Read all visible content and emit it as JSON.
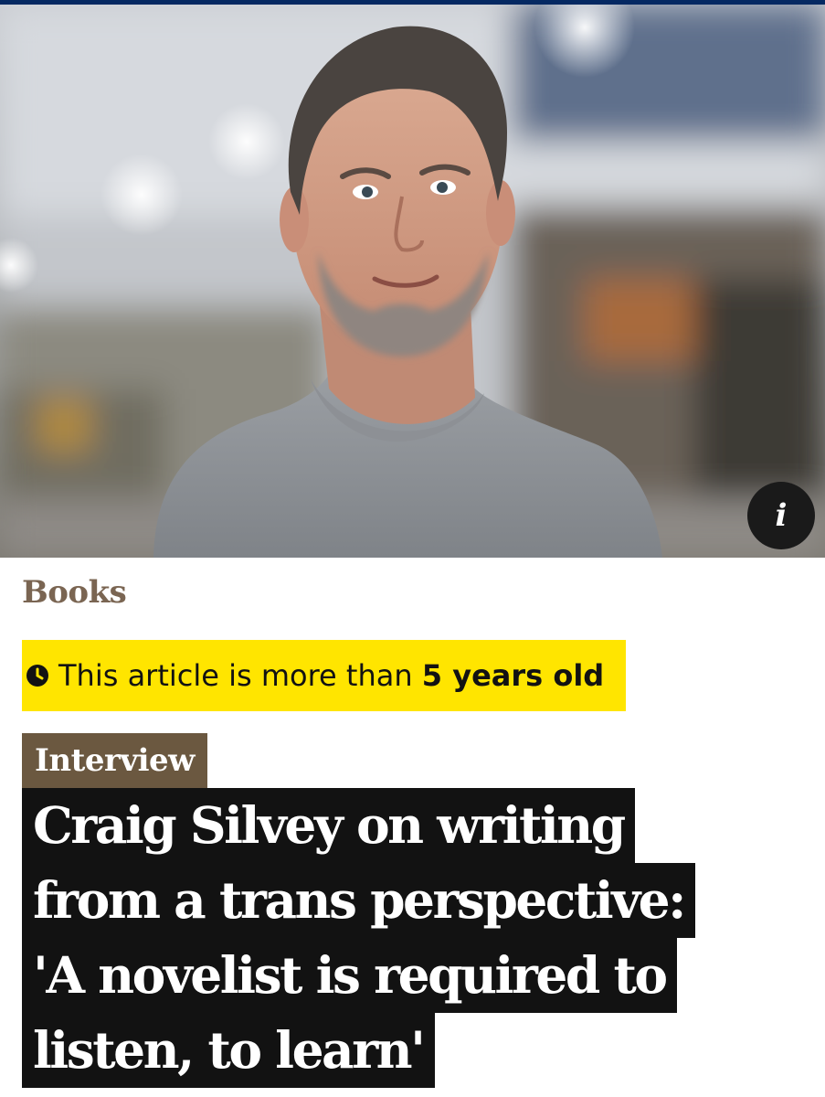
{
  "colors": {
    "brand_bar": "#052962",
    "section_label": "#7a6552",
    "age_warning_bg": "#ffe500",
    "kicker_bg": "#6b5840",
    "headline_bg": "#121212",
    "headline_text": "#ffffff"
  },
  "hero": {
    "info_icon": "i",
    "icon_name": "info-icon"
  },
  "section": {
    "label": "Books"
  },
  "age_warning": {
    "icon": "clock-icon",
    "text_prefix": "This article is more than ",
    "text_bold": "5 years old"
  },
  "article": {
    "kicker": "Interview",
    "headline_lines": [
      "Craig Silvey on writing",
      "from a trans perspective:",
      "'A novelist is required to",
      "listen, to learn'"
    ]
  }
}
